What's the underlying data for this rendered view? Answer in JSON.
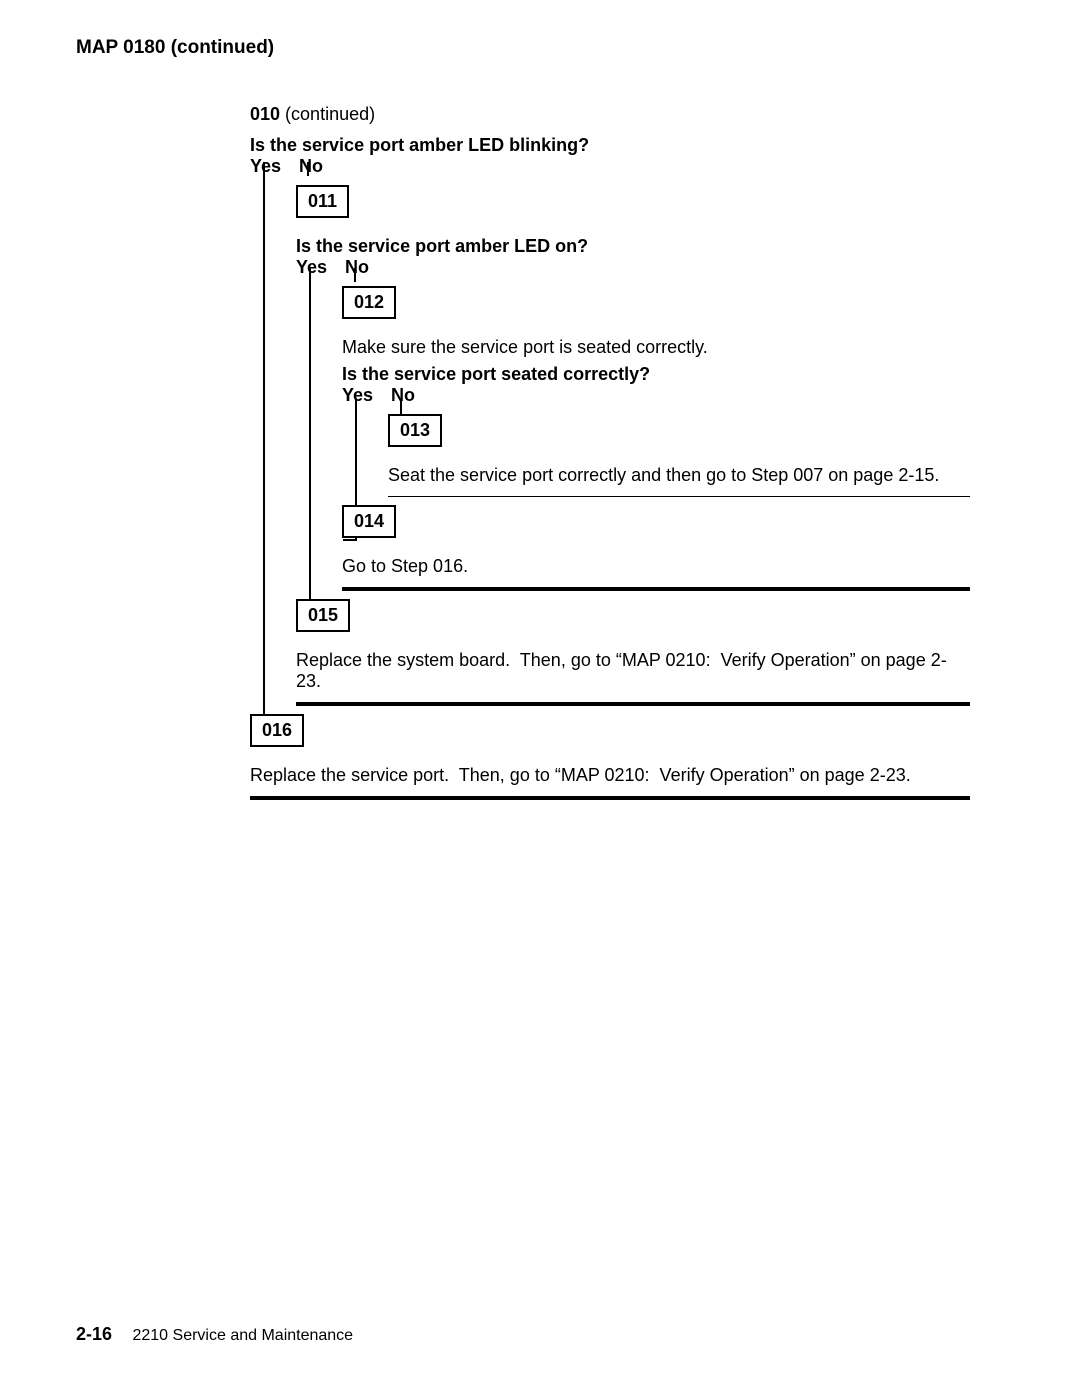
{
  "header_title": "MAP 0180 (continued)",
  "step010_number": "010",
  "step010_suffix": " (continued)",
  "q1": "Is the service port amber LED blinking?",
  "yes": "Yes",
  "no": "No",
  "box011": "011",
  "q2": "Is the service port amber LED on?",
  "box012": "012",
  "instr012": "Make sure the service port is seated correctly.",
  "q3": "Is the service port seated correctly?",
  "box013": "013",
  "instr013": "Seat the service port correctly and then go to Step 007 on page 2-15.",
  "box014": "014",
  "instr014": "Go to Step 016.",
  "box015": "015",
  "instr015": "Replace the system board.  Then, go to “MAP 0210:  Verify Operation” on page 2-23.",
  "box016": "016",
  "instr016": "Replace the service port.  Then, go to “MAP 0210:  Verify Operation” on page 2-23.",
  "footer_pagenum": "2-16",
  "footer_title": "2210 Service and Maintenance"
}
